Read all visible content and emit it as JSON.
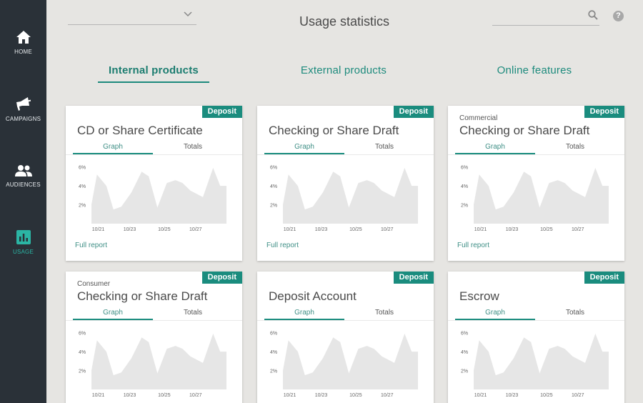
{
  "nav": {
    "items": [
      {
        "label": "HOME",
        "icon": "home-icon"
      },
      {
        "label": "CAMPAIGNS",
        "icon": "megaphone-icon"
      },
      {
        "label": "AUDIENCES",
        "icon": "people-icon"
      },
      {
        "label": "USAGE",
        "icon": "bar-chart-icon"
      }
    ],
    "active": "USAGE"
  },
  "header": {
    "title": "Usage statistics",
    "select_value": "",
    "search_placeholder": "",
    "help_glyph": "?"
  },
  "categories": {
    "tabs": [
      "Internal products",
      "External products",
      "Online features"
    ],
    "active": "Internal products"
  },
  "cards": [
    {
      "badge": "Deposit",
      "subtitle": "",
      "title": "CD or Share Certificate",
      "tabs": [
        "Graph",
        "Totals"
      ],
      "link": "Full report"
    },
    {
      "badge": "Deposit",
      "subtitle": "",
      "title": "Checking or Share Draft",
      "tabs": [
        "Graph",
        "Totals"
      ],
      "link": "Full report"
    },
    {
      "badge": "Deposit",
      "subtitle": "Commercial",
      "title": "Checking or Share Draft",
      "tabs": [
        "Graph",
        "Totals"
      ],
      "link": "Full report"
    },
    {
      "badge": "Deposit",
      "subtitle": "Consumer",
      "title": "Checking or Share Draft",
      "tabs": [
        "Graph",
        "Totals"
      ],
      "link": ""
    },
    {
      "badge": "Deposit",
      "subtitle": "",
      "title": "Deposit Account",
      "tabs": [
        "Graph",
        "Totals"
      ],
      "link": ""
    },
    {
      "badge": "Deposit",
      "subtitle": "",
      "title": "Escrow",
      "tabs": [
        "Graph",
        "Totals"
      ],
      "link": ""
    }
  ],
  "chart_data": {
    "type": "area",
    "y_ticks": [
      "6%",
      "4%",
      "2%"
    ],
    "ylim": [
      0,
      6.8
    ],
    "x_ticks": [
      "10/21",
      "10/23",
      "10/25",
      "10/27"
    ],
    "x": [
      0,
      0.35,
      0.95,
      1.4,
      1.9,
      2.55,
      3.2,
      3.65,
      4.2,
      4.8,
      5.35,
      5.8,
      6.3,
      7.1,
      7.75,
      8.2,
      8.6
    ],
    "values": [
      2.0,
      5.2,
      4.0,
      1.5,
      1.8,
      3.3,
      5.5,
      5.0,
      1.7,
      4.3,
      4.6,
      4.3,
      3.5,
      2.8,
      5.9,
      4.0,
      4.0
    ],
    "x_tick_positions": [
      0.4,
      2.4,
      4.6,
      6.6
    ],
    "xlim": [
      0,
      8.6
    ],
    "grid": false,
    "legend": "none",
    "fill_color": "#e6e6e6"
  }
}
